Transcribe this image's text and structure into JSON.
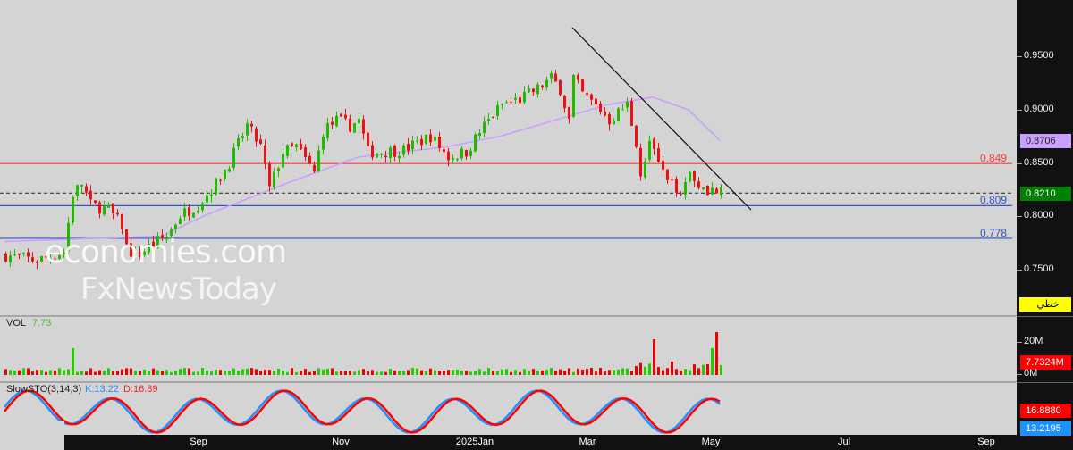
{
  "chart_data": {
    "type": "candlestick",
    "title": "",
    "price_axis": {
      "ticks": [
        "0.9500",
        "0.9000",
        "0.8500",
        "0.8000",
        "0.7500"
      ],
      "tick_values": [
        0.95,
        0.9,
        0.85,
        0.8,
        0.75
      ],
      "range": [
        0.715,
        0.99
      ]
    },
    "time_axis": {
      "ticks": [
        "Sep",
        "Nov",
        "2025Jan",
        "Mar",
        "May",
        "Jul",
        "Sep"
      ]
    },
    "close_waypoints": [
      [
        0,
        0.762
      ],
      [
        7,
        0.757
      ],
      [
        13,
        0.765
      ],
      [
        15,
        0.82
      ],
      [
        17,
        0.83
      ],
      [
        19,
        0.81
      ],
      [
        23,
        0.805
      ],
      [
        26,
        0.79
      ],
      [
        27,
        0.77
      ],
      [
        29,
        0.76
      ],
      [
        32,
        0.77
      ],
      [
        36,
        0.78
      ],
      [
        39,
        0.8
      ],
      [
        43,
        0.81
      ],
      [
        47,
        0.83
      ],
      [
        50,
        0.85
      ],
      [
        54,
        0.885
      ],
      [
        57,
        0.865
      ],
      [
        59,
        0.825
      ],
      [
        62,
        0.86
      ],
      [
        65,
        0.865
      ],
      [
        69,
        0.84
      ],
      [
        71,
        0.88
      ],
      [
        74,
        0.89
      ],
      [
        77,
        0.885
      ],
      [
        79,
        0.89
      ],
      [
        81,
        0.86
      ],
      [
        84,
        0.86
      ],
      [
        89,
        0.862
      ],
      [
        95,
        0.875
      ],
      [
        99,
        0.855
      ],
      [
        103,
        0.86
      ],
      [
        107,
        0.885
      ],
      [
        111,
        0.905
      ],
      [
        115,
        0.91
      ],
      [
        119,
        0.92
      ],
      [
        122,
        0.93
      ],
      [
        124,
        0.92
      ],
      [
        126,
        0.89
      ],
      [
        127,
        0.93
      ],
      [
        129,
        0.915
      ],
      [
        133,
        0.9
      ],
      [
        135,
        0.89
      ],
      [
        139,
        0.905
      ],
      [
        141,
        0.87
      ],
      [
        142,
        0.84
      ],
      [
        144,
        0.87
      ],
      [
        146,
        0.85
      ],
      [
        148,
        0.83
      ],
      [
        151,
        0.825
      ],
      [
        153,
        0.84
      ],
      [
        155,
        0.83
      ],
      [
        157,
        0.825
      ],
      [
        160,
        0.821
      ]
    ],
    "moving_average": {
      "color": "#c9a0ff",
      "last": "0.8706",
      "waypoints": [
        [
          0,
          0.775
        ],
        [
          35,
          0.78
        ],
        [
          45,
          0.8
        ],
        [
          63,
          0.83
        ],
        [
          79,
          0.855
        ],
        [
          99,
          0.865
        ],
        [
          111,
          0.875
        ],
        [
          123,
          0.89
        ],
        [
          135,
          0.905
        ],
        [
          145,
          0.912
        ],
        [
          153,
          0.9
        ],
        [
          160,
          0.871
        ]
      ]
    },
    "horizontal_levels": [
      {
        "label": "0.849",
        "value": 0.849,
        "color": "#ff3b3b"
      },
      {
        "label": "0.809",
        "value": 0.809,
        "color": "#3355cc"
      },
      {
        "label": "0.778",
        "value": 0.778,
        "color": "#3355cc"
      }
    ],
    "current_price": {
      "label": "0.8210",
      "value": 0.821,
      "color": "#008000"
    },
    "trendline": {
      "from": [
        127,
        0.978
      ],
      "to": [
        167,
        0.805
      ]
    },
    "volume": {
      "label": "VOL",
      "value": "7.73",
      "ticks": [
        "20M",
        "0M"
      ],
      "last": "7.7324M",
      "up_color": "#22cc00",
      "down_color": "#ee0000"
    },
    "stochastic": {
      "label": "SlowSTO(3,14,3)",
      "k": "K:13.22",
      "d": "D:16.89",
      "k_last": "13.2195",
      "d_last": "16.8880",
      "k_color": "#1e90ff",
      "d_color": "#ff0000"
    },
    "chart_type_badge": "خطي"
  },
  "watermark": {
    "line1": "economies.com",
    "line2": "FxNewsToday"
  }
}
